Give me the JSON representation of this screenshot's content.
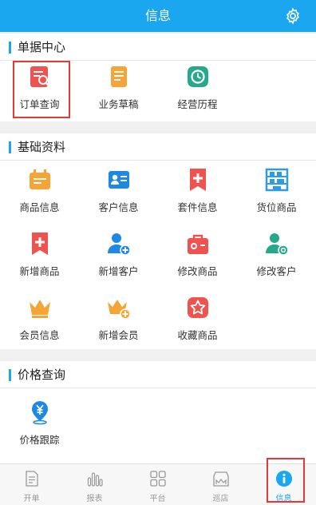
{
  "header": {
    "title": "信息"
  },
  "sections": {
    "bills": {
      "title": "单据中心",
      "items": [
        {
          "label": "订单查询",
          "icon": "order-search-icon",
          "color": "#ef5350"
        },
        {
          "label": "业务草稿",
          "icon": "draft-icon",
          "color": "#f7a436"
        },
        {
          "label": "经营历程",
          "icon": "history-icon",
          "color": "#26a98b"
        }
      ]
    },
    "basic": {
      "title": "基础资料",
      "items": [
        {
          "label": "商品信息",
          "icon": "product-info-icon",
          "color": "#f7a436"
        },
        {
          "label": "客户信息",
          "icon": "customer-info-icon",
          "color": "#1e88e5"
        },
        {
          "label": "套件信息",
          "icon": "bundle-icon",
          "color": "#ef5350"
        },
        {
          "label": "货位商品",
          "icon": "shelf-icon",
          "color": "#2f9be0"
        },
        {
          "label": "新增商品",
          "icon": "add-product-icon",
          "color": "#ef5350"
        },
        {
          "label": "新增客户",
          "icon": "add-customer-icon",
          "color": "#1e88e5"
        },
        {
          "label": "修改商品",
          "icon": "edit-product-icon",
          "color": "#ef5350"
        },
        {
          "label": "修改客户",
          "icon": "edit-customer-icon",
          "color": "#26a98b"
        },
        {
          "label": "会员信息",
          "icon": "member-icon",
          "color": "#f7a436"
        },
        {
          "label": "新增会员",
          "icon": "add-member-icon",
          "color": "#f7a436"
        },
        {
          "label": "收藏商品",
          "icon": "favorite-icon",
          "color": "#ef5350"
        }
      ]
    },
    "price": {
      "title": "价格查询",
      "items": [
        {
          "label": "价格跟踪",
          "icon": "price-track-icon",
          "color": "#1e88e5"
        }
      ]
    }
  },
  "tabbar": {
    "items": [
      {
        "label": "开单",
        "icon": "document-icon"
      },
      {
        "label": "报表",
        "icon": "bar-chart-icon"
      },
      {
        "label": "平台",
        "icon": "grid-icon"
      },
      {
        "label": "巡店",
        "icon": "store-icon"
      },
      {
        "label": "信息",
        "icon": "info-icon",
        "active": true
      }
    ]
  },
  "colors": {
    "accent": "#1aa7f0",
    "highlight": "#e53935"
  }
}
